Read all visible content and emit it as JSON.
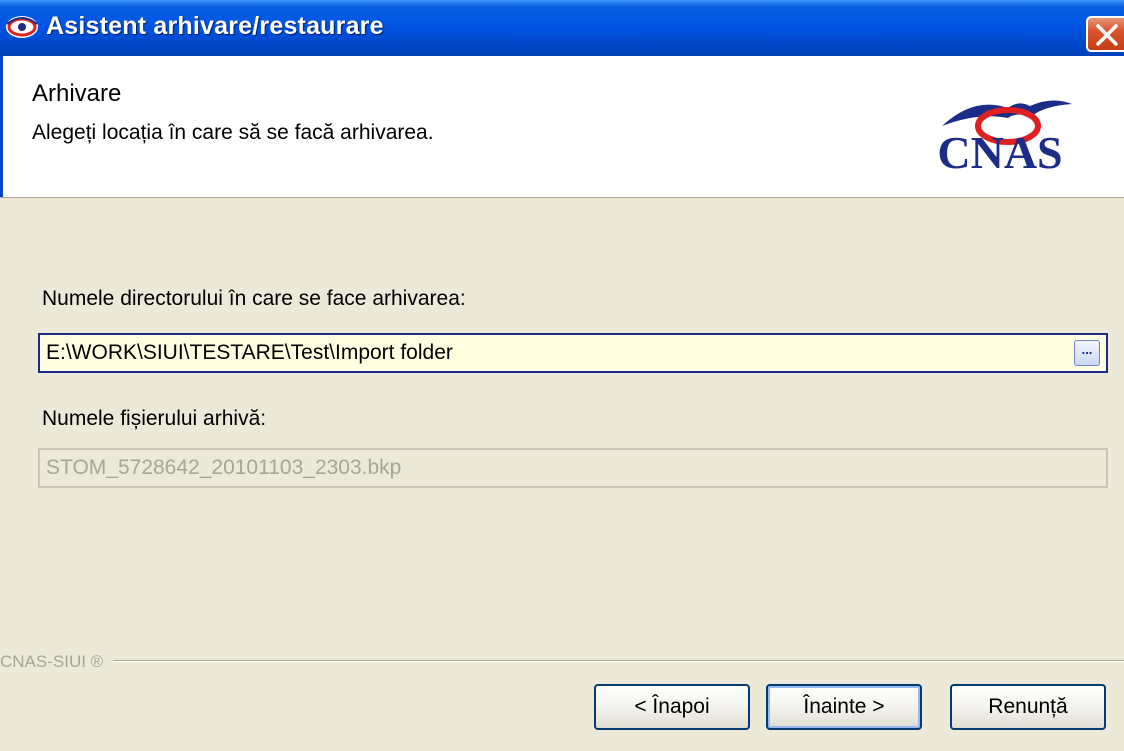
{
  "window": {
    "title": "Asistent arhivare/restaurare",
    "icon": "cnas-eye-icon",
    "close_icon": "close-icon"
  },
  "header": {
    "title": "Arhivare",
    "subtitle": "Alegeți locația în care să se facă arhivarea.",
    "logo_text": "CNAS"
  },
  "form": {
    "directory_label": "Numele directorului în care se face arhivarea:",
    "directory_value": "E:\\WORK\\SIUI\\TESTARE\\Test\\Import folder",
    "browse_label": "...",
    "file_label": "Numele fișierului arhivă:",
    "file_value": "STOM_5728642_20101103_2303.bkp",
    "file_disabled": true
  },
  "footer": {
    "brand": "CNAS-SIUI ®",
    "buttons": {
      "back": "< Înapoi",
      "next": "Înainte >",
      "cancel": "Renunță"
    }
  },
  "colors": {
    "titlebar": "#0055e5",
    "accent_red": "#d8552e",
    "logo_blue": "#1c2d88",
    "logo_red": "#e02020",
    "input_bg": "#ffffe1",
    "dialog_bg": "#ece9d8"
  }
}
